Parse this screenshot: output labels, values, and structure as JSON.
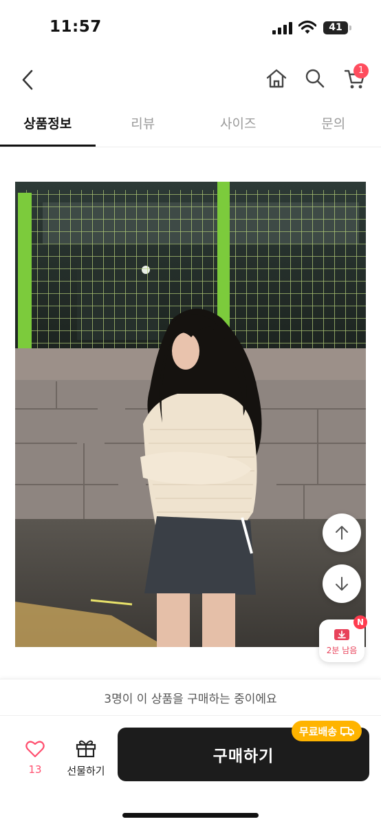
{
  "status_bar": {
    "time": "11:57",
    "battery": "41"
  },
  "header": {
    "cart_count": "1"
  },
  "tabs": [
    {
      "label": "상품정보",
      "active": true
    },
    {
      "label": "리뷰",
      "active": false
    },
    {
      "label": "사이즈",
      "active": false
    },
    {
      "label": "문의",
      "active": false
    }
  ],
  "timer_badge": {
    "new_mark": "N",
    "label": "2분 남음"
  },
  "bottom": {
    "buying_notice": "3명이 이 상품을 구매하는 중이에요",
    "like_count": "13",
    "gift_label": "선물하기",
    "buy_label": "구매하기",
    "shipping_badge": "무료배송"
  },
  "colors": {
    "accent_red": "#ff4d5e",
    "badge_yellow": "#ffb400",
    "buy_button": "#1c1c1c"
  }
}
